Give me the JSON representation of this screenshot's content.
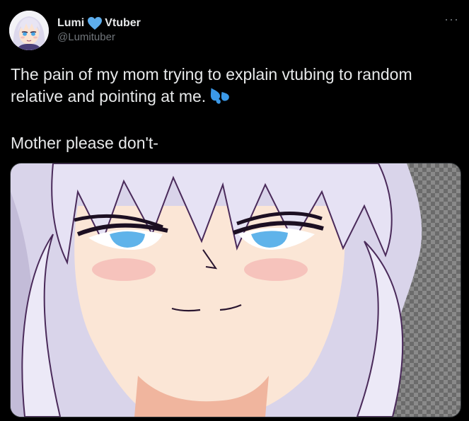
{
  "tweet": {
    "display_name": "Lumi",
    "name_suffix": "Vtuber",
    "handle": "@Lumituber",
    "more_label": "···",
    "text_line1": "The pain of my mom trying to explain vtubing to random relative and pointing at me.",
    "text_line2": "Mother please don't-"
  },
  "icons": {
    "name_heart": "blue-heart-icon",
    "text_emoji": "sweat-droplets-icon",
    "more": "more-dots-icon"
  },
  "colors": {
    "background": "#000000",
    "text_primary": "#e7e9ea",
    "text_secondary": "#71767b",
    "heart_blue": "#5dadec",
    "emoji_blue": "#3b99e8"
  }
}
